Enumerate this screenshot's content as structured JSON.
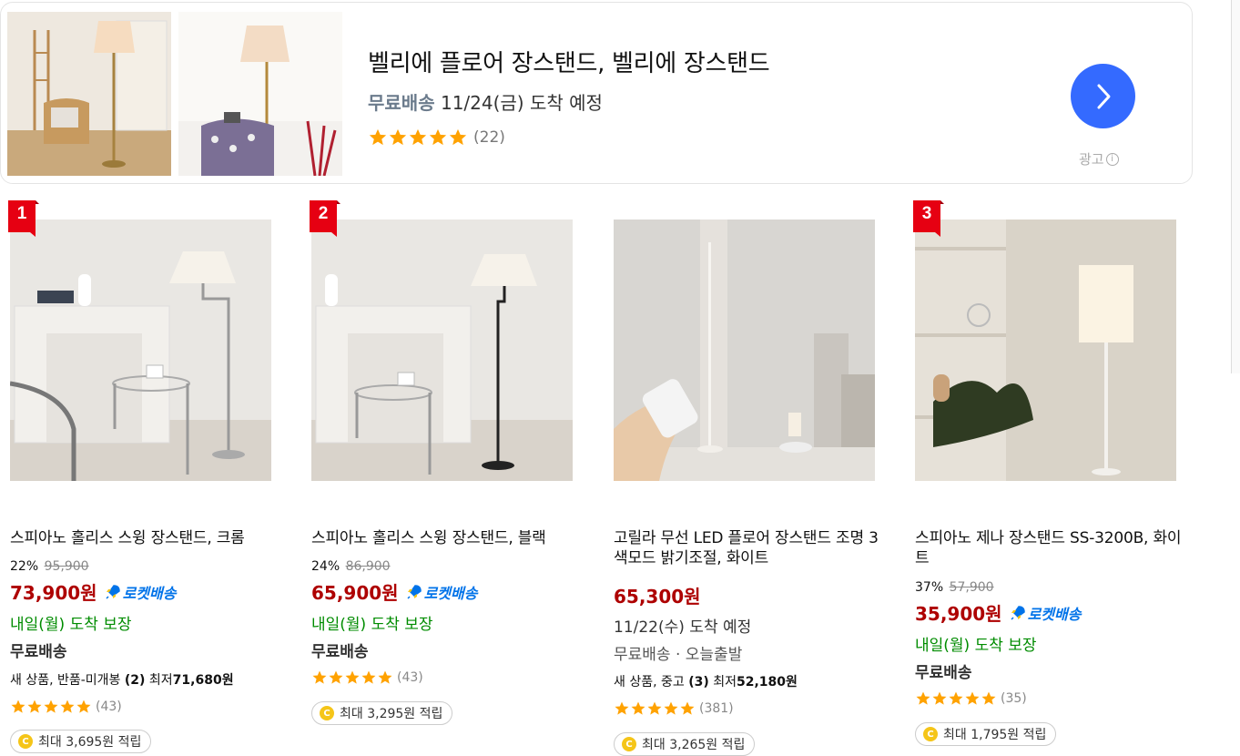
{
  "ad": {
    "title": "벨리에 플로어 장스탠드, 벨리에 장스탠드",
    "free_shipping": "무료배송",
    "arrival": "11/24(금) 도착 예정",
    "rating": 5,
    "review_count": "(22)",
    "label": "광고",
    "info_icon": "info-icon",
    "next_icon": "chevron-right-icon",
    "accent_color": "#346aff"
  },
  "products": [
    {
      "rank": "1",
      "name": "스피아노 홀리스 스윙 장스탠드, 크롬",
      "discount_rate": "22%",
      "original_price": "95,900",
      "price": "73,900원",
      "rocket": "로켓배송",
      "arrival": "내일(월) 도착 보장",
      "shipping": "무료배송",
      "other_offer_prefix": "새 상품, 반품-미개봉 ",
      "other_offer_count": "(2)",
      "other_offer_mid": " 최저",
      "other_offer_price": "71,680원",
      "rating": 5,
      "review_count": "(43)",
      "reward": "최대 3,695원 적립"
    },
    {
      "rank": "2",
      "name": "스피아노 홀리스 스윙 장스탠드, 블랙",
      "discount_rate": "24%",
      "original_price": "86,900",
      "price": "65,900원",
      "rocket": "로켓배송",
      "arrival": "내일(월) 도착 보장",
      "shipping": "무료배송",
      "rating": 5,
      "review_count": "(43)",
      "reward": "최대 3,295원 적립"
    },
    {
      "name": "고릴라 무선 LED 플로어 장스탠드 조명 3색모드 밝기조절, 화이트",
      "price": "65,300원",
      "arrival": "11/22(수) 도착 예정",
      "shipping": "무료배송 · 오늘출발",
      "other_offer_prefix": "새 상품, 중고 ",
      "other_offer_count": "(3)",
      "other_offer_mid": " 최저",
      "other_offer_price": "52,180원",
      "rating": 5,
      "review_count": "(381)",
      "reward": "최대 3,265원 적립"
    },
    {
      "rank": "3",
      "name": "스피아노 제나 장스탠드 SS-3200B, 화이트",
      "discount_rate": "37%",
      "original_price": "57,900",
      "price": "35,900원",
      "rocket": "로켓배송",
      "arrival": "내일(월) 도착 보장",
      "shipping": "무료배송",
      "rating": 5,
      "review_count": "(35)",
      "reward": "최대 1,795원 적립"
    }
  ],
  "colors": {
    "price": "#ae0000",
    "rocket": "#0073e9",
    "arrival": "#008c00",
    "star": "#ffa200",
    "rank_badge": "#e60012"
  }
}
